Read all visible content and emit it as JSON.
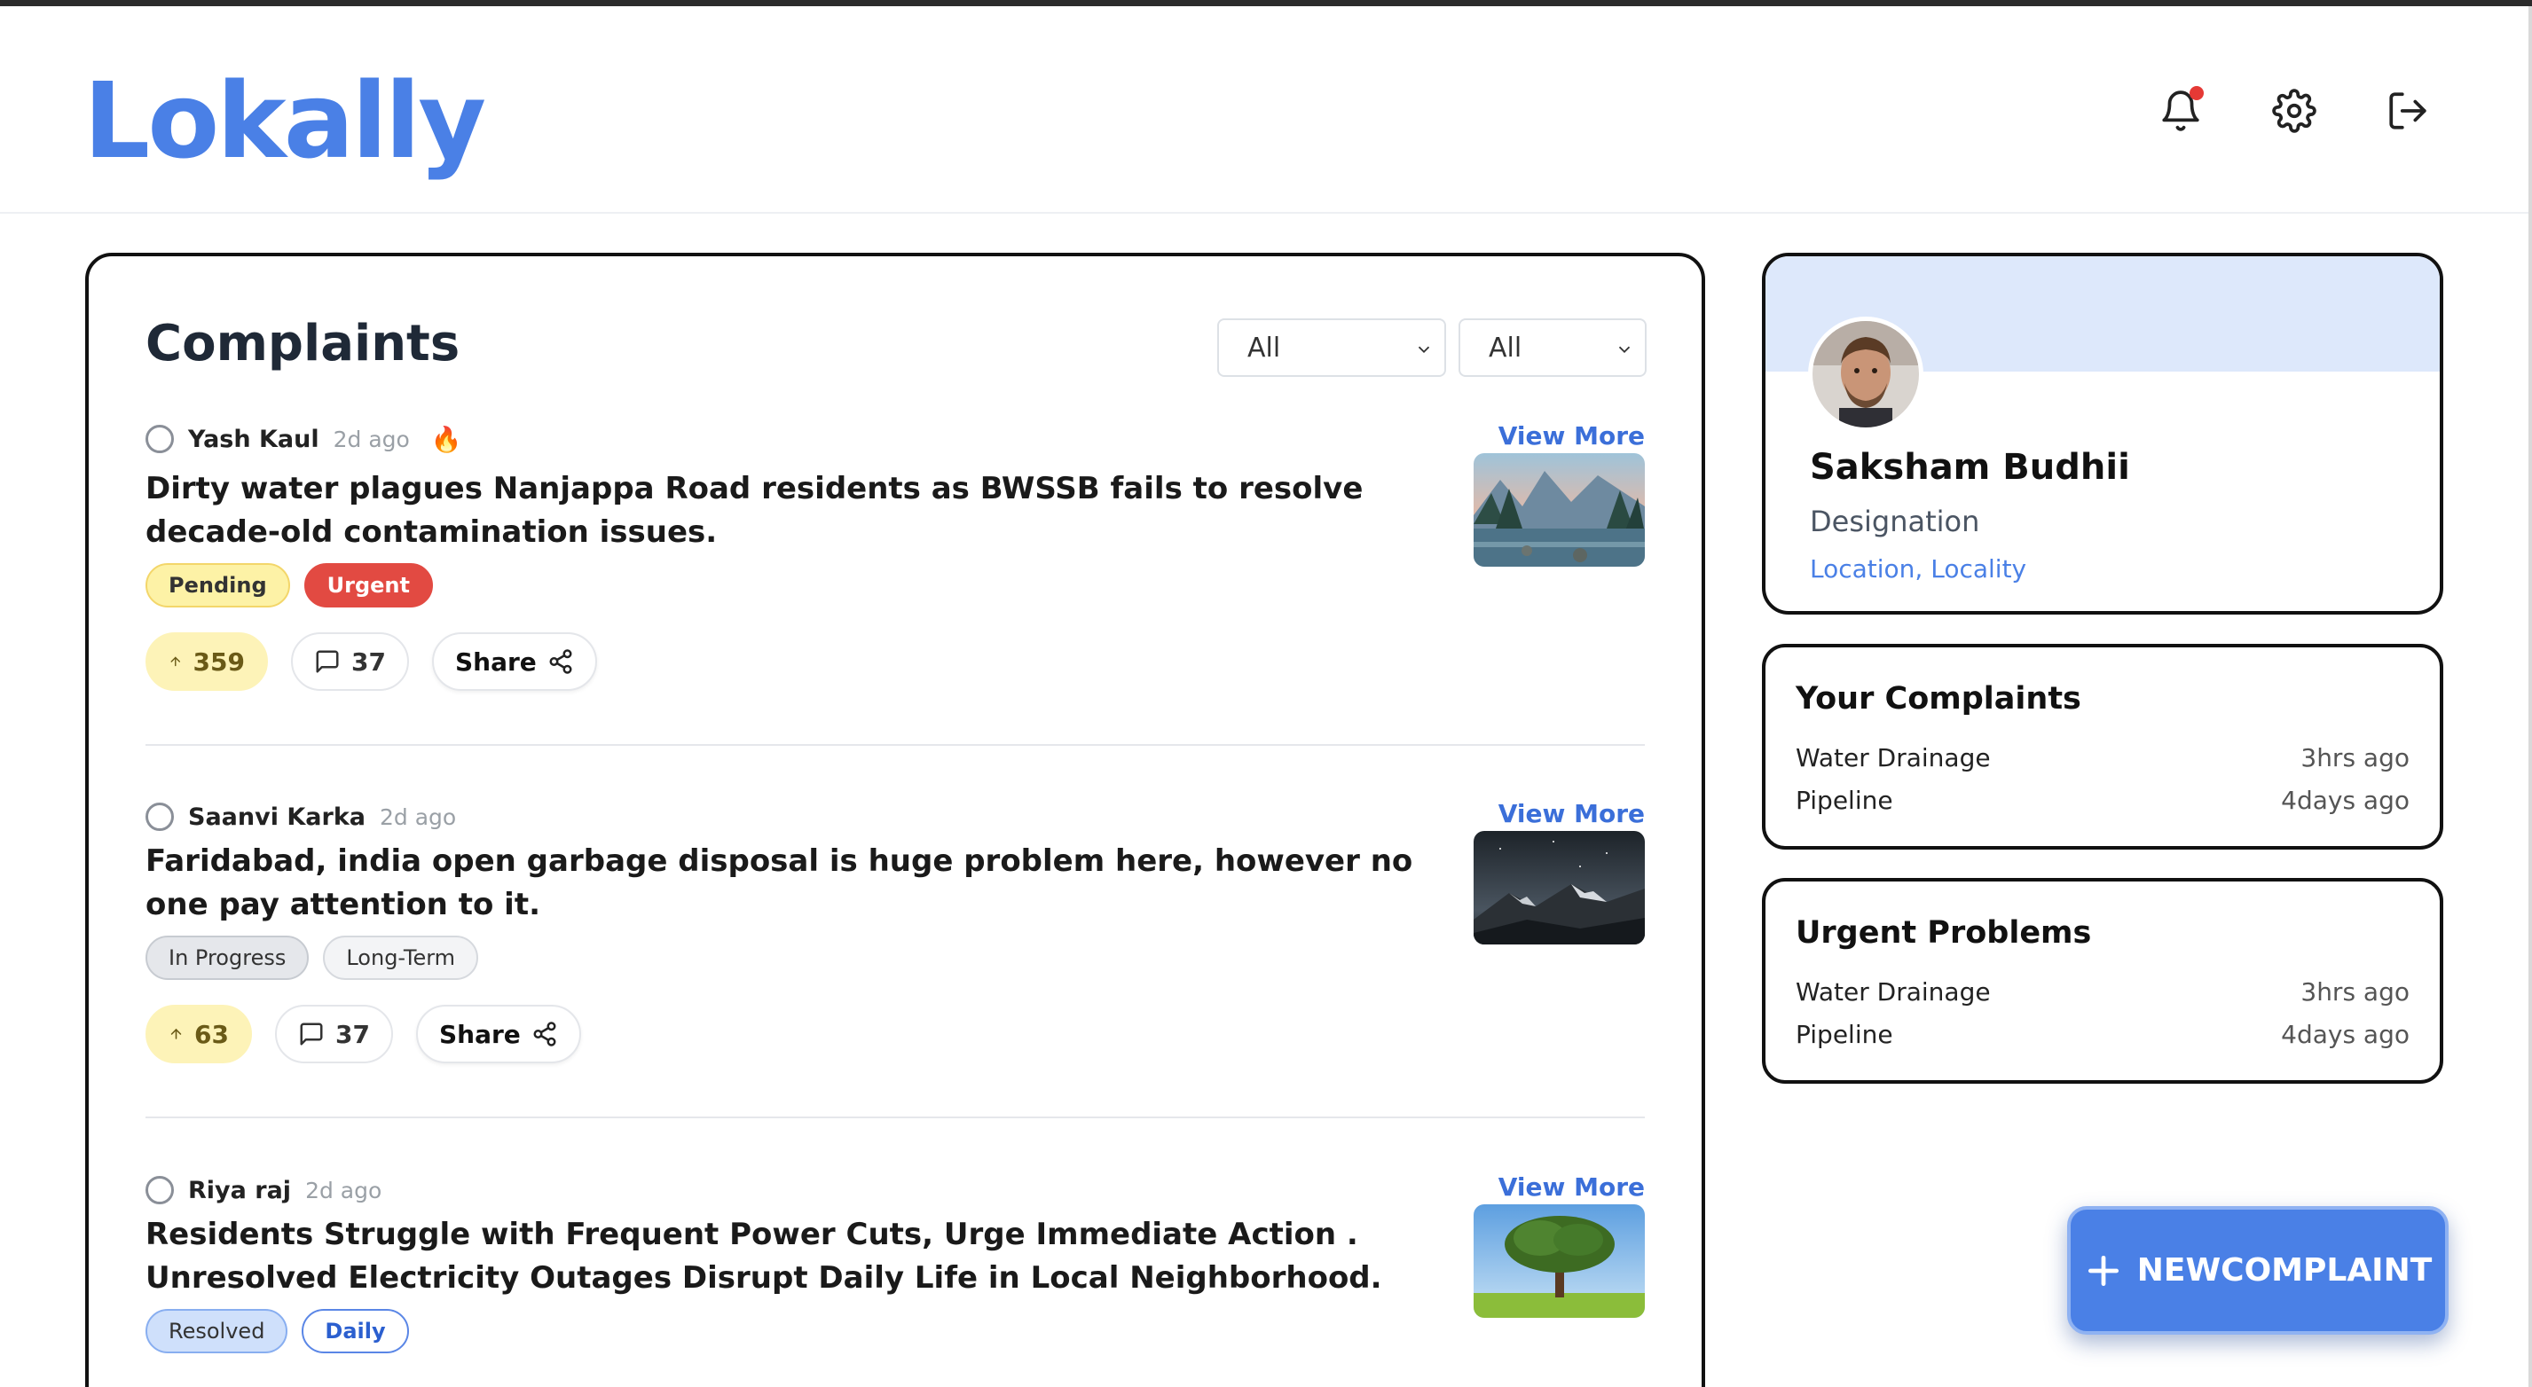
{
  "app": {
    "name": "Lokally"
  },
  "header": {
    "icons": [
      "bell-icon",
      "gear-icon",
      "logout-icon"
    ],
    "notification_dot_color": "#e53935"
  },
  "complaints": {
    "title": "Complaints",
    "filters": [
      {
        "selected": "All"
      },
      {
        "selected": "All"
      }
    ],
    "view_more_label": "View More",
    "share_label": "Share",
    "posts": [
      {
        "author": "Yash Kaul",
        "time": "2d ago",
        "trending": true,
        "title": "Dirty water plagues Nanjappa Road residents as BWSSB fails to resolve decade-old contamination issues.",
        "tags": [
          "Pending",
          "Urgent"
        ],
        "upvotes": "359",
        "comments": "37",
        "thumbnail": "mountain-lake"
      },
      {
        "author": "Saanvi Karka",
        "time": "2d ago",
        "trending": false,
        "title": "Faridabad, india open garbage disposal is huge problem here, however no one pay attention to it.",
        "tags": [
          "In Progress",
          "Long-Term"
        ],
        "upvotes": "63",
        "comments": "37",
        "thumbnail": "night-mountains"
      },
      {
        "author": "Riya raj",
        "time": "2d ago",
        "trending": false,
        "title": "Residents Struggle with Frequent Power Cuts, Urge Immediate Action . Unresolved Electricity Outages Disrupt Daily Life in Local Neighborhood.",
        "tags": [
          "Resolved",
          "Daily"
        ],
        "thumbnail": "tree-field"
      }
    ]
  },
  "profile": {
    "name": "Saksham Budhii",
    "designation": "Designation",
    "location": "Location, Locality"
  },
  "your_complaints": {
    "title": "Your Complaints",
    "items": [
      {
        "label": "Water Drainage",
        "when": "3hrs ago"
      },
      {
        "label": "Pipeline",
        "when": "4days ago"
      }
    ]
  },
  "urgent_problems": {
    "title": "Urgent Problems",
    "items": [
      {
        "label": "Water Drainage",
        "when": "3hrs ago"
      },
      {
        "label": "Pipeline",
        "when": "4days ago"
      }
    ]
  },
  "fab": {
    "label": "NEWCOMPLAINT"
  },
  "colors": {
    "accent": "#4a80e6",
    "urgent": "#e24a42",
    "pending": "#fdf2a6"
  }
}
